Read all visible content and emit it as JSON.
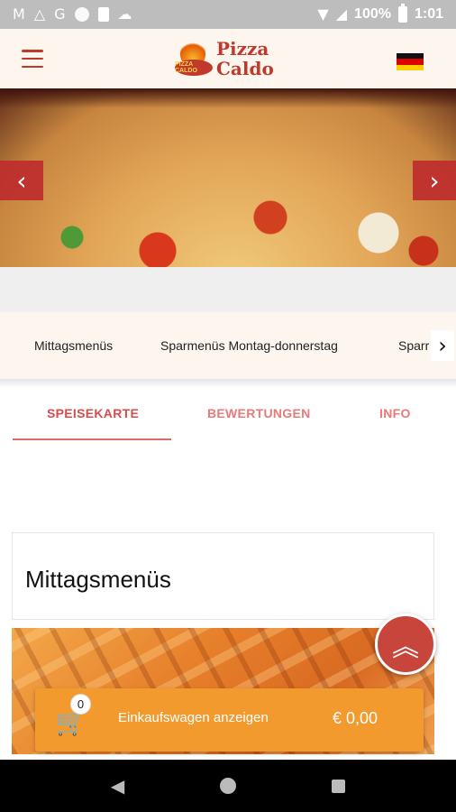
{
  "status_bar": {
    "left_icons": [
      "gmail-icon",
      "drive-icon",
      "google-icon",
      "circle-icon",
      "sim-icon",
      "cloud-icon"
    ],
    "battery_percent": "100%",
    "time": "1:01"
  },
  "header": {
    "logo_line1": "Pizza",
    "logo_line2": "Caldo",
    "logo_plate_text": "PIZZA CALDO",
    "language_flag": "de"
  },
  "hero": {
    "prev_glyph": "‹",
    "next_glyph": "›"
  },
  "categories": {
    "items": [
      "Mittagsmenüs",
      "Sparmenüs Montag-donnerstag",
      "Sparr"
    ],
    "more_glyph": "›"
  },
  "tabs": [
    {
      "label": "SPEISEKARTE",
      "active": true
    },
    {
      "label": "BEWERTUNGEN",
      "active": false
    },
    {
      "label": "INFO",
      "active": false
    }
  ],
  "section": {
    "title": "Mittagsmenüs"
  },
  "fab": {
    "glyph": "︽"
  },
  "cart": {
    "count": "0",
    "label": "Einkaufswagen anzeigen",
    "total": "€ 0,00"
  },
  "colors": {
    "accent": "#c8453c",
    "cart_orange": "#f39a2e",
    "header_bg": "#fdf6ef",
    "tab_active": "#d84c4c"
  }
}
